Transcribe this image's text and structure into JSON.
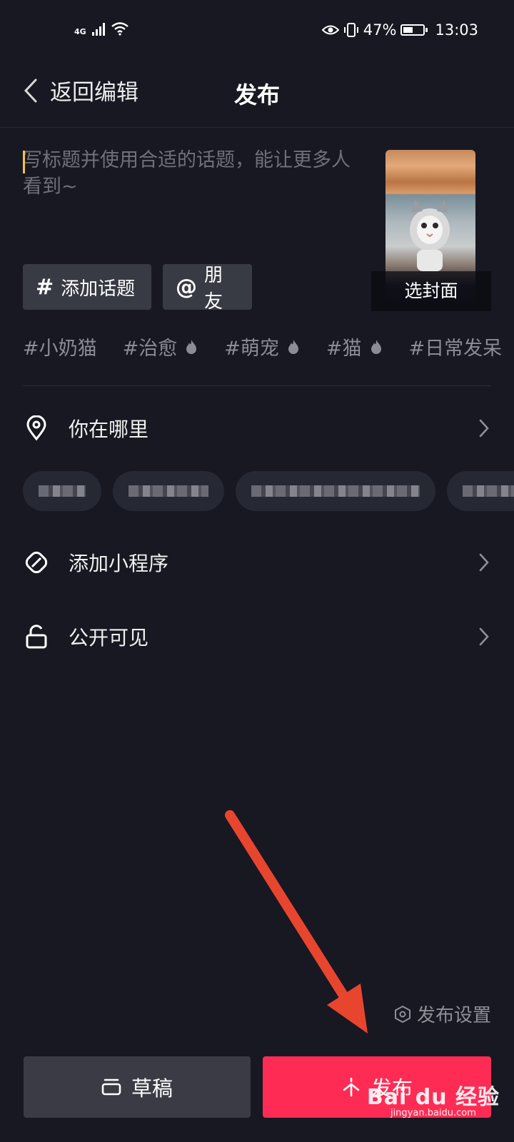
{
  "status_bar": {
    "network": "4G",
    "battery": "47%",
    "battery_level": 0.47,
    "time": "13:03"
  },
  "header": {
    "back_label": "返回编辑",
    "title": "发布"
  },
  "caption": {
    "placeholder": "写标题并使用合适的话题，能让更多人看到~"
  },
  "cover": {
    "label": "选封面"
  },
  "chips": {
    "topic_icon": "#",
    "topic_label": "添加话题",
    "friend_icon": "@",
    "friend_label": "朋友"
  },
  "hashtags": [
    {
      "text": "#小奶猫",
      "hot": false
    },
    {
      "text": "#治愈",
      "hot": true
    },
    {
      "text": "#萌宠",
      "hot": true
    },
    {
      "text": "#猫",
      "hot": true
    },
    {
      "text": "#日常发呆",
      "hot": false
    }
  ],
  "options": {
    "location": {
      "label": "你在哪里",
      "icon": "location-pin-icon"
    },
    "mini_program": {
      "label": "添加小程序",
      "icon": "link-icon"
    },
    "visibility": {
      "label": "公开可见",
      "icon": "unlock-icon"
    }
  },
  "footer": {
    "settings_label": "发布设置",
    "draft_label": "草稿",
    "publish_label": "发布",
    "publish_color": "#fe2c55",
    "annotation_color": "#e8452f"
  },
  "watermark": {
    "main": "Bai du 经验",
    "sub": "jingyan.baidu.com"
  }
}
